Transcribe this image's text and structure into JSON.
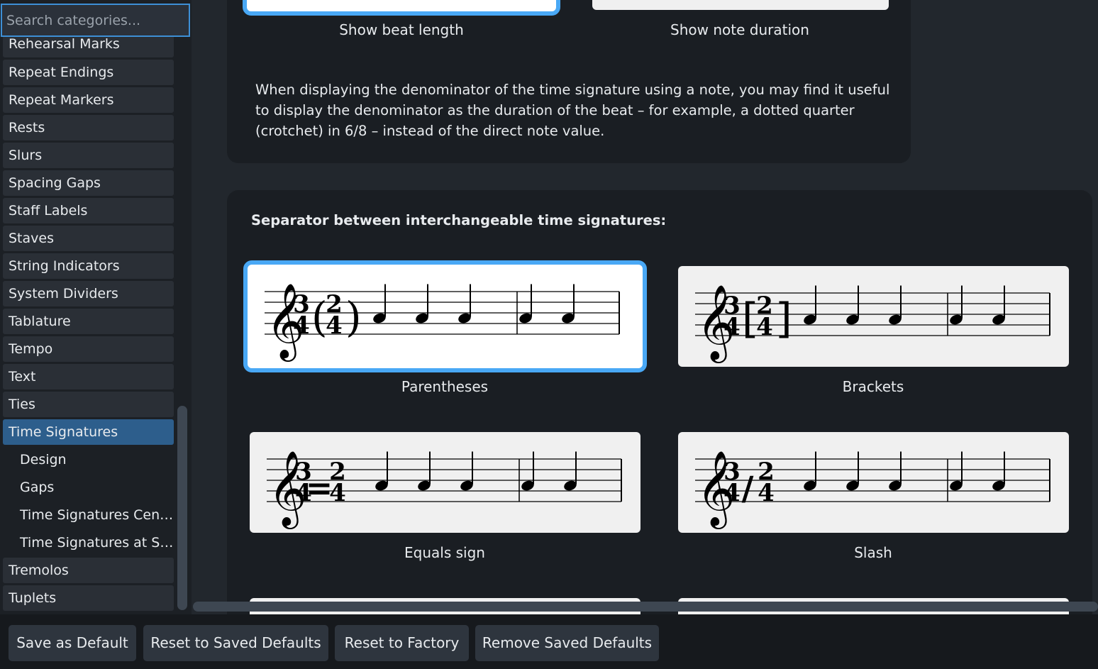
{
  "sidebar": {
    "search_placeholder": "Search categories...",
    "items": [
      {
        "label": "Rehearsal Marks"
      },
      {
        "label": "Repeat Endings"
      },
      {
        "label": "Repeat Markers"
      },
      {
        "label": "Rests"
      },
      {
        "label": "Slurs"
      },
      {
        "label": "Spacing Gaps"
      },
      {
        "label": "Staff Labels"
      },
      {
        "label": "Staves"
      },
      {
        "label": "String Indicators"
      },
      {
        "label": "System Dividers"
      },
      {
        "label": "Tablature"
      },
      {
        "label": "Tempo"
      },
      {
        "label": "Text"
      },
      {
        "label": "Ties"
      },
      {
        "label": "Time Signatures"
      },
      {
        "label": "Design"
      },
      {
        "label": "Gaps"
      },
      {
        "label": "Time Signatures Centered"
      },
      {
        "label": "Time Signatures at Syste..."
      },
      {
        "label": "Tremolos"
      },
      {
        "label": "Tuplets"
      }
    ],
    "selected": "Time Signatures"
  },
  "beat_options": {
    "show_beat_length": "Show beat length",
    "show_note_duration": "Show note duration",
    "description": "When displaying the denominator of the time signature using a note, you may find it useful to display the denominator as the duration of the beat – for example, a dotted quarter (crotchet) in 6/8 – instead of the direct note value."
  },
  "separator": {
    "heading": "Separator between interchangeable time signatures:",
    "options": [
      {
        "label": "Parentheses",
        "glyph_left": "(",
        "glyph_right": ")",
        "selected": true
      },
      {
        "label": "Brackets",
        "glyph_left": "[",
        "glyph_right": "]",
        "selected": false
      },
      {
        "label": "Equals sign",
        "glyph_mid": "=",
        "selected": false
      },
      {
        "label": "Slash",
        "glyph_mid": "/",
        "selected": false
      }
    ],
    "time_sig_a": {
      "num": "3",
      "den": "4"
    },
    "time_sig_b": {
      "num": "2",
      "den": "4"
    }
  },
  "footer": {
    "save_default": "Save as Default",
    "reset_saved": "Reset to Saved Defaults",
    "reset_factory": "Reset to Factory",
    "remove_saved": "Remove Saved Defaults"
  },
  "colors": {
    "accent": "#49a8f5",
    "selected_item": "#2d5e8c"
  }
}
